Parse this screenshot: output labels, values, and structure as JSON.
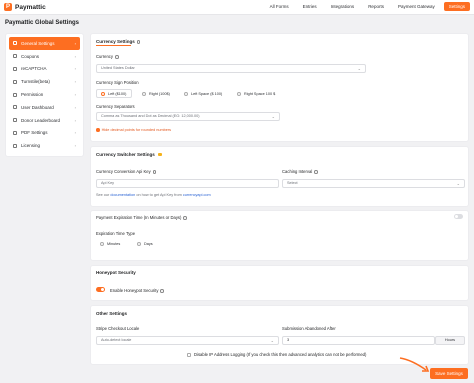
{
  "app": {
    "logo_letter": "P",
    "name": "Paymattic"
  },
  "nav": [
    {
      "label": "All Forms",
      "active": false
    },
    {
      "label": "Entries",
      "active": false
    },
    {
      "label": "Integrations",
      "active": false
    },
    {
      "label": "Reports",
      "active": false
    },
    {
      "label": "Payment Gateway",
      "active": false
    },
    {
      "label": "Settings",
      "active": true
    }
  ],
  "page_title": "Paymattic Global Settings",
  "sidebar": [
    {
      "label": "General Settings",
      "icon": "sliders-icon",
      "active": true
    },
    {
      "label": "Coupons",
      "icon": "coupon-icon",
      "active": false
    },
    {
      "label": "reCAPTCHA",
      "icon": "shield-icon",
      "active": false
    },
    {
      "label": "Turnstile(beta)",
      "icon": "shield-icon",
      "active": false
    },
    {
      "label": "Permission",
      "icon": "lock-icon",
      "active": false
    },
    {
      "label": "User Dashboard",
      "icon": "user-icon",
      "active": false
    },
    {
      "label": "Donor Leaderboard",
      "icon": "trophy-icon",
      "active": false
    },
    {
      "label": "PDF Settings",
      "icon": "file-icon",
      "active": false
    },
    {
      "label": "Licensing",
      "icon": "key-icon",
      "active": false
    }
  ],
  "currency": {
    "section_title": "Currency Settings",
    "currency_label": "Currency",
    "currency_value": "United States Dollar",
    "sign_position_label": "Currency Sign Position",
    "sign_options": [
      {
        "label": "Left ($100)",
        "checked": true
      },
      {
        "label": "Right (100$)",
        "checked": false
      },
      {
        "label": "Left Space ($ 100)",
        "checked": false
      },
      {
        "label": "Right Space 100 $",
        "checked": false
      }
    ],
    "separators_label": "Currency Separators",
    "separators_value": "Comma as Thousand and Dot as Decimal (EG: 12,000.00)",
    "hide_decimal": "Hide decimal points for rounded numbers"
  },
  "switcher": {
    "section_title": "Currency Switcher Settings",
    "api_key_label": "Currency Conversion Api Key",
    "api_key_placeholder": "Api Key",
    "docs_prefix": "See our",
    "docs_link": "documentation",
    "docs_middle": "on how to get Api Key from",
    "docs_site": "currencyapi.com",
    "caching_label": "Caching Interval",
    "caching_placeholder": "Select"
  },
  "expiration": {
    "title": "Payment Expiration Time (In Minutes or Days)",
    "type_label": "Expiration Time Type",
    "options": [
      {
        "label": "Minutes",
        "checked": false
      },
      {
        "label": "Days",
        "checked": false
      }
    ]
  },
  "honeypot": {
    "section_title": "Honeypot Security",
    "toggle_label": "Enable Honeypot Security",
    "enabled": true
  },
  "other": {
    "section_title": "Other Settings",
    "checkout_label": "Stripe Checkout Locale",
    "checkout_value": "Auto-detect locale",
    "abandoned_label": "Submission Abandoned After",
    "abandoned_value": "3",
    "abandoned_unit": "Hours",
    "disable_ip": "Disable IP Address Logging (If you check this then advanced analytics can not be performed)"
  },
  "save_button": "Save Settings",
  "colors": {
    "accent": "#fd6e21"
  }
}
